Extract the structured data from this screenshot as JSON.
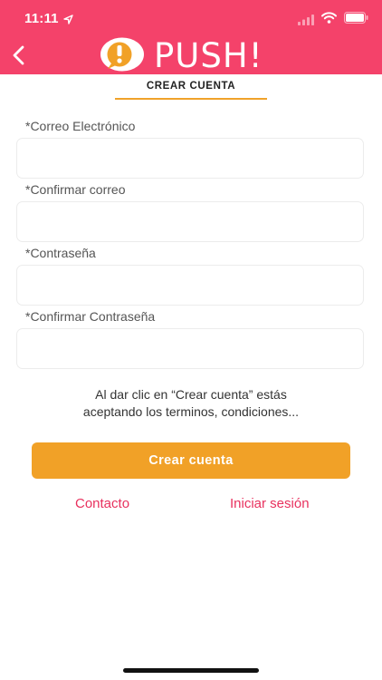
{
  "status_bar": {
    "time": "11:11"
  },
  "header": {
    "logo_text": "PUSH!",
    "accent_color": "#f4426a"
  },
  "section": {
    "tab_label": "CREAR CUENTA",
    "underline_color": "#f0a22a"
  },
  "form": {
    "email_label": "*Correo Electrónico",
    "email_value": "",
    "confirm_email_label": "*Confirmar correo",
    "confirm_email_value": "",
    "password_label": "*Contraseña",
    "password_value": "",
    "confirm_password_label": "*Confirmar Contraseña",
    "confirm_password_value": ""
  },
  "terms": {
    "line1": "Al dar clic en “Crear cuenta” estás",
    "line2": "aceptando los terminos, condiciones..."
  },
  "actions": {
    "create_label": "Crear cuenta",
    "create_color": "#f1a127",
    "contact_label": "Contacto",
    "login_label": "Iniciar sesión",
    "link_color": "#e8315e"
  }
}
